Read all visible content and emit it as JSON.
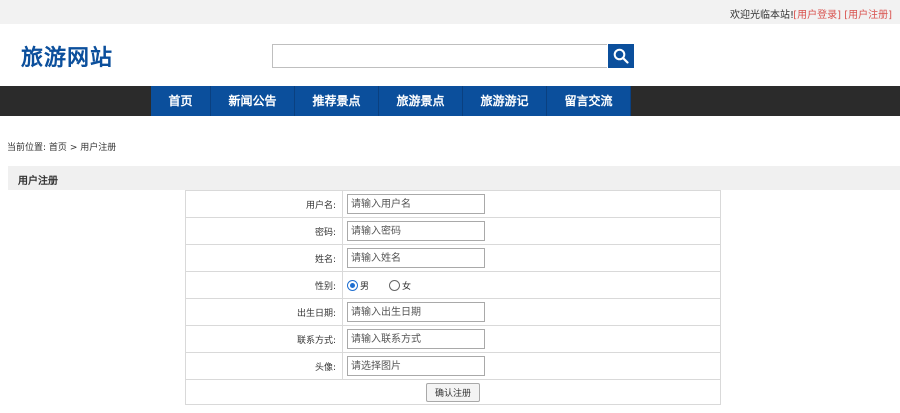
{
  "topbar": {
    "welcome": "欢迎光临本站!",
    "login": "[用户登录]",
    "register": "[用户注册]"
  },
  "header": {
    "logo": "旅游网站",
    "search_icon": "search-icon"
  },
  "nav": {
    "items": [
      "首页",
      "新闻公告",
      "推荐景点",
      "旅游景点",
      "旅游游记",
      "留言交流"
    ]
  },
  "breadcrumb": {
    "prefix": "当前位置:",
    "home": "首页",
    "separator": ">",
    "current": "用户注册"
  },
  "section": {
    "title": "用户注册"
  },
  "form": {
    "username": {
      "label": "用户名:",
      "placeholder": "请输入用户名"
    },
    "password": {
      "label": "密码:",
      "placeholder": "请输入密码"
    },
    "name": {
      "label": "姓名:",
      "placeholder": "请输入姓名"
    },
    "gender": {
      "label": "性别:",
      "male": "男",
      "female": "女",
      "selected": "男"
    },
    "birthday": {
      "label": "出生日期:",
      "placeholder": "请输入出生日期"
    },
    "contact": {
      "label": "联系方式:",
      "placeholder": "请输入联系方式"
    },
    "avatar": {
      "label": "头像:",
      "placeholder": "请选择图片"
    },
    "submit": "确认注册"
  },
  "colors": {
    "brand": "#0b4f9c",
    "nav_bg": "#2b2b2b",
    "link": "#d9534f"
  }
}
